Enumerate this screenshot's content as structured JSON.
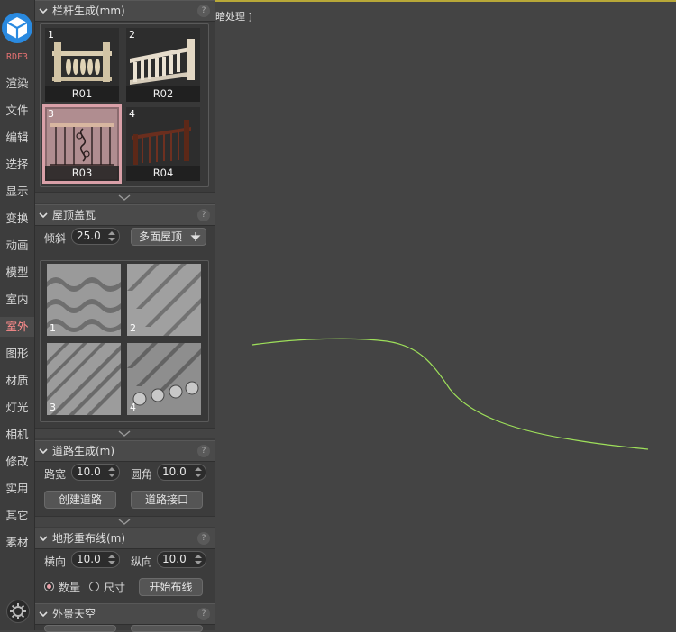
{
  "nav": {
    "items": [
      "RDF3",
      "渲染",
      "文件",
      "编辑",
      "选择",
      "显示",
      "变换",
      "动画",
      "模型",
      "室内",
      "室外",
      "图形",
      "材质",
      "灯光",
      "相机",
      "修改",
      "实用",
      "其它",
      "素材"
    ],
    "active": "室外"
  },
  "railing": {
    "title": "栏杆生成(mm)",
    "help": "?",
    "items": [
      {
        "num": "1",
        "label": "R01"
      },
      {
        "num": "2",
        "label": "R02"
      },
      {
        "num": "3",
        "label": "R03"
      },
      {
        "num": "4",
        "label": "R04"
      }
    ],
    "selected": 3
  },
  "roof": {
    "title": "屋顶盖瓦",
    "help": "?",
    "slope_label": "倾斜",
    "slope_value": "25.0",
    "multi_button": "多面屋顶",
    "tiles": [
      "1",
      "2",
      "3",
      "4"
    ]
  },
  "road": {
    "title": "道路生成(m)",
    "help": "?",
    "width_label": "路宽",
    "width_value": "10.0",
    "corner_label": "圆角",
    "corner_value": "10.0",
    "create_button": "创建道路",
    "joint_button": "道路接口"
  },
  "terrain": {
    "title": "地形重布线(m)",
    "help": "?",
    "h_label": "横向",
    "h_value": "10.0",
    "v_label": "纵向",
    "v_value": "10.0",
    "opt_count": "数量",
    "opt_size": "尺寸",
    "start_button": "开始布线"
  },
  "sky": {
    "title": "外景天空",
    "help": "?"
  },
  "viewport": {
    "label": "暗处理 ]",
    "curve_color": "#9ee05a"
  },
  "colors": {
    "accent_pink": "#d9a0a8",
    "top_border": "#b8a838"
  }
}
